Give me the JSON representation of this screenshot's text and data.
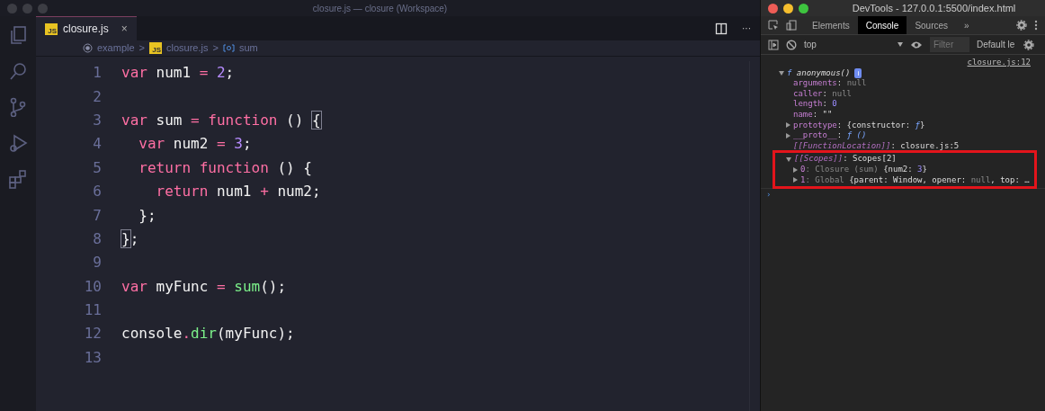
{
  "editor": {
    "window_title": "closure.js — closure (Workspace)",
    "tabs": [
      {
        "label": "closure.js",
        "badge": "JS",
        "close": "×",
        "selected": true
      }
    ],
    "breadcrumb": [
      {
        "label": "example",
        "kind": "folder"
      },
      {
        "label": "closure.js",
        "kind": "file",
        "badge": "JS"
      },
      {
        "label": "sum",
        "kind": "symbol"
      }
    ],
    "separators": [
      ">",
      ">"
    ],
    "more": "···",
    "lines": [
      {
        "number": "1",
        "tokens": [
          {
            "t": "var",
            "kind": "kw"
          },
          {
            "t": " num1 ",
            "kind": "id"
          },
          {
            "t": "=",
            "kind": "op"
          },
          {
            "t": " 2",
            "kind": "num"
          },
          {
            "t": ";",
            "kind": "id"
          }
        ]
      },
      {
        "number": "2"
      },
      {
        "number": "3",
        "tokens": [
          {
            "t": "var",
            "kind": "kw"
          },
          {
            "t": " sum ",
            "kind": "id"
          },
          {
            "t": "=",
            "kind": "op"
          },
          {
            "t": " function",
            "kind": "kw"
          },
          {
            "t": " () ",
            "kind": "id"
          },
          {
            "t": "{",
            "kind": "match"
          }
        ]
      },
      {
        "number": "4",
        "tokens": [
          {
            "t": "  var",
            "kind": "kw"
          },
          {
            "t": " num2 ",
            "kind": "id"
          },
          {
            "t": "=",
            "kind": "op"
          },
          {
            "t": " 3",
            "kind": "num"
          },
          {
            "t": ";",
            "kind": "id"
          }
        ]
      },
      {
        "number": "5",
        "tokens": [
          {
            "t": "  return",
            "kind": "kw"
          },
          {
            "t": " function",
            "kind": "kw"
          },
          {
            "t": " () {",
            "kind": "id"
          }
        ]
      },
      {
        "number": "6",
        "tokens": [
          {
            "t": "    return",
            "kind": "kw"
          },
          {
            "t": " num1 ",
            "kind": "id"
          },
          {
            "t": "+",
            "kind": "op"
          },
          {
            "t": " num2;",
            "kind": "id"
          }
        ]
      },
      {
        "number": "7",
        "tokens": [
          {
            "t": "  };",
            "kind": "id"
          }
        ]
      },
      {
        "number": "8",
        "tokens": [
          {
            "t": "}",
            "kind": "match"
          },
          {
            "t": ";",
            "kind": "id"
          }
        ]
      },
      {
        "number": "9"
      },
      {
        "number": "10",
        "tokens": [
          {
            "t": "var",
            "kind": "kw"
          },
          {
            "t": " myFunc ",
            "kind": "id"
          },
          {
            "t": "=",
            "kind": "op"
          },
          {
            "t": " sum",
            "kind": "fn"
          },
          {
            "t": "();",
            "kind": "id"
          }
        ]
      },
      {
        "number": "11"
      },
      {
        "number": "12",
        "tokens": [
          {
            "t": "console",
            "kind": "id"
          },
          {
            "t": ".",
            "kind": "op"
          },
          {
            "t": "dir",
            "kind": "fn"
          },
          {
            "t": "(myFunc);",
            "kind": "id"
          }
        ]
      },
      {
        "number": "13"
      }
    ]
  },
  "devtools": {
    "window_title": "DevTools - 127.0.0.1:5500/index.html",
    "tabs": [
      {
        "label": "Elements",
        "selected": false
      },
      {
        "label": "Console",
        "selected": true
      },
      {
        "label": "Sources",
        "selected": false
      }
    ],
    "overflow": "»",
    "context": "top",
    "filter": {
      "placeholder": "Filter"
    },
    "levels": "Default le",
    "source_link": "closure.js:12",
    "root": {
      "prefix": "f",
      "name": "anonymous()",
      "info": "i",
      "expanded": true,
      "children": [
        {
          "key": "arguments",
          "parts": [
            {
              "t": ": ",
              "kind": "plain"
            },
            {
              "t": "null",
              "kind": "null"
            }
          ],
          "expandable": false
        },
        {
          "key": "caller",
          "parts": [
            {
              "t": ": ",
              "kind": "plain"
            },
            {
              "t": "null",
              "kind": "null"
            }
          ],
          "expandable": false
        },
        {
          "key": "length",
          "parts": [
            {
              "t": ": ",
              "kind": "plain"
            },
            {
              "t": "0",
              "kind": "num"
            }
          ],
          "expandable": false
        },
        {
          "key": "name",
          "parts": [
            {
              "t": ": \"\"",
              "kind": "plain"
            }
          ],
          "expandable": false
        },
        {
          "key": "prototype",
          "parts": [
            {
              "t": ": {constructor: ",
              "kind": "plain"
            },
            {
              "t": "ƒ",
              "kind": "fn"
            },
            {
              "t": "}",
              "kind": "plain"
            }
          ],
          "expandable": true,
          "expanded": false
        },
        {
          "key": "__proto__",
          "parts": [
            {
              "t": ": ",
              "kind": "plain"
            },
            {
              "t": "ƒ ()",
              "kind": "fn"
            }
          ],
          "expandable": true,
          "expanded": false
        },
        {
          "key": "[[FunctionLocation]]",
          "internal": true,
          "parts": [
            {
              "t": ": closure.js:5",
              "kind": "plain"
            }
          ],
          "expandable": false
        },
        {
          "key": "[[Scopes]]",
          "internal": true,
          "highlighted": true,
          "parts": [
            {
              "t": ": Scopes[2]",
              "kind": "plain"
            }
          ],
          "expandable": true,
          "expanded": true,
          "children": [
            {
              "key": "0",
              "parts": [
                {
                  "t": ": Closure (sum) ",
                  "kind": "dim"
                },
                {
                  "t": "{num2: ",
                  "kind": "plain"
                },
                {
                  "t": "3",
                  "kind": "num"
                },
                {
                  "t": "}",
                  "kind": "plain"
                }
              ],
              "expandable": true,
              "expanded": false
            },
            {
              "key": "1",
              "parts": [
                {
                  "t": ": Global ",
                  "kind": "dim"
                },
                {
                  "t": "{parent: Window, opener: ",
                  "kind": "plain"
                },
                {
                  "t": "null",
                  "kind": "null"
                },
                {
                  "t": ", top: …",
                  "kind": "plain"
                }
              ],
              "expandable": true,
              "expanded": false
            }
          ]
        }
      ]
    },
    "prompt": "›"
  }
}
